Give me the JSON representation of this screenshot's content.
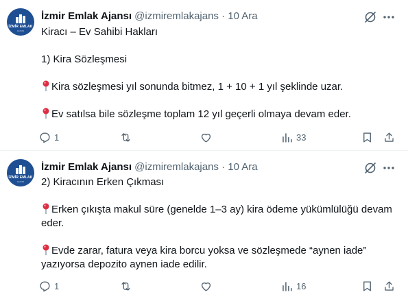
{
  "tweets": [
    {
      "author_name": "İzmir Emlak Ajansı",
      "handle": "@izmiremlakajans",
      "separator": "·",
      "date": "10 Ara",
      "lines": [
        "Kiracı – Ev Sahibi Hakları",
        "1) Kira Sözleşmesi",
        "Kira sözleşmesi yıl sonunda bitmez, 1 + 10 + 1 yıl şeklinde uzar.",
        "Ev satılsa bile sözleşme toplam 12 yıl geçerli olmaya devam eder."
      ],
      "replies": "1",
      "retweets": "",
      "likes": "",
      "views": "33"
    },
    {
      "author_name": "İzmir Emlak Ajansı",
      "handle": "@izmiremlakajans",
      "separator": "·",
      "date": "10 Ara",
      "lines": [
        "2) Kiracının Erken Çıkması",
        "Erken çıkışta makul süre (genelde 1–3 ay) kira ödeme yükümlülüğü devam eder.",
        "Evde zarar, fatura veya kira borcu yoksa ve sözleşmede “aynen iade” yazıyorsa depozito aynen iade edilir."
      ],
      "replies": "1",
      "retweets": "",
      "likes": "",
      "views": "16"
    }
  ],
  "avatar_logo_text": "İZMİR EMLAK",
  "avatar_logo_sub": "AJANSI",
  "icons": {
    "bullet": "round-pushpin-icon",
    "reply": "reply-icon",
    "retweet": "retweet-icon",
    "like": "heart-icon",
    "views": "views-icon",
    "bookmark": "bookmark-icon",
    "share": "share-icon",
    "grok": "grok-icon",
    "more": "more-icon"
  },
  "colors": {
    "text": "#0f1419",
    "muted": "#536471",
    "avatar_bg": "#1f4f93",
    "pin_red": "#dd2e44",
    "divider": "#eff3f4"
  }
}
